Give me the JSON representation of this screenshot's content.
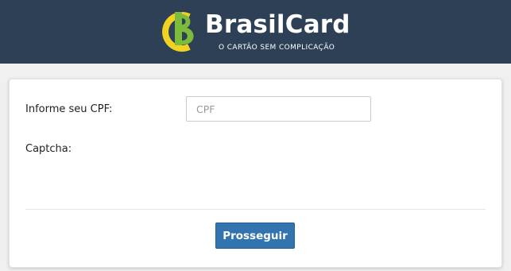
{
  "header": {
    "brand_name": "BrasilCard",
    "tagline": "O CARTÃO SEM COMPLICAÇÃO",
    "logo_icon": "brasilcard-logo-icon"
  },
  "form": {
    "cpf_label": "Informe seu CPF:",
    "cpf_placeholder": "CPF",
    "cpf_value": "",
    "captcha_label": "Captcha:",
    "submit_label": "Prosseguir"
  },
  "colors": {
    "header_bg": "#2d4056",
    "logo_yellow": "#f2d221",
    "logo_green": "#7dbb3c",
    "button_bg": "#3274b0"
  }
}
